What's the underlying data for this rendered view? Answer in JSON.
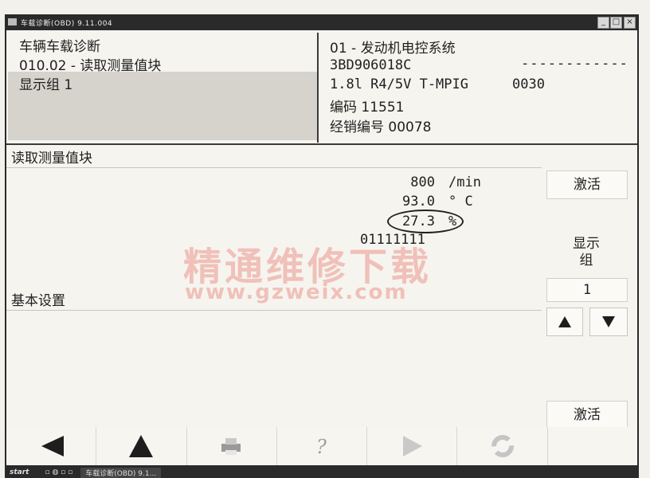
{
  "window": {
    "title": "车载诊断(OBD) 9.11.004",
    "controls": [
      "_",
      "□",
      "×"
    ]
  },
  "header_left": {
    "line1": "车辆车载诊断",
    "line2": "010.02 - 读取测量值块",
    "line3": "显示组 1"
  },
  "header_right": {
    "line1": "01 - 发动机电控系统",
    "line2": "3BD906018C",
    "line2_dashes": "------------",
    "line3_part1": "1.8l R4/5V T-MPIG",
    "line3_part2": "0030",
    "line4": "编码 11551",
    "line5": "经销编号 00078"
  },
  "section1": {
    "title": "读取测量值块",
    "values": [
      "800",
      "93.0",
      "27.3",
      "01111111"
    ],
    "units": [
      "/min",
      "° C",
      "%",
      ""
    ]
  },
  "section2": {
    "title": "基本设置"
  },
  "side": {
    "activate_label": "激活",
    "display_group_line1": "显示",
    "display_group_line2": "组",
    "group_number": "1",
    "activate_label_2": "激活"
  },
  "toolbar": {
    "icons": [
      "arrow-left-icon",
      "arrow-up-icon",
      "print-icon",
      "help-icon",
      "play-icon",
      "refresh-icon"
    ]
  },
  "taskbar": {
    "start_label": "start",
    "task_label": "车载诊断(OBD) 9.1..."
  },
  "watermark": {
    "line1": "精通维修下载",
    "line2": "www.gzweix.com"
  }
}
